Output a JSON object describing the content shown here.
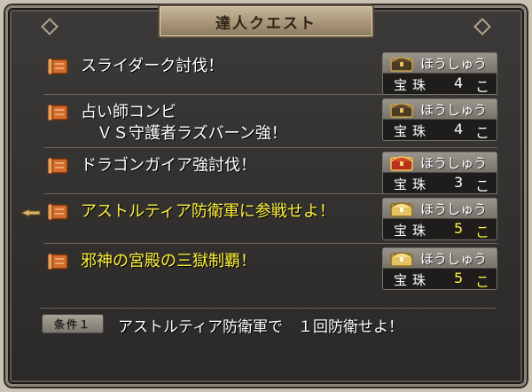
{
  "window": {
    "title": "達人クエスト"
  },
  "quests": [
    {
      "name": "スライダーク討伐！",
      "highlight": false,
      "reward_label": "ほうしゅう",
      "item": "宝珠",
      "count": "4",
      "unit": "こ",
      "chest": "dark-chest-icon"
    },
    {
      "name": "占い師コンビ\n　ＶＳ守護者ラズバーン強！",
      "highlight": false,
      "reward_label": "ほうしゅう",
      "item": "宝珠",
      "count": "4",
      "unit": "こ",
      "chest": "dark-chest-icon"
    },
    {
      "name": "ドラゴンガイア強討伐！",
      "highlight": false,
      "reward_label": "ほうしゅう",
      "item": "宝珠",
      "count": "3",
      "unit": "こ",
      "chest": "red-chest-icon"
    },
    {
      "name": "アストルティア防衛軍に参戦せよ！",
      "highlight": true,
      "reward_label": "ほうしゅう",
      "item": "宝珠",
      "count": "5",
      "unit": "こ",
      "chest": "gold-chest-icon"
    },
    {
      "name": "邪神の宮殿の三獄制覇！",
      "highlight": true,
      "reward_label": "ほうしゅう",
      "item": "宝珠",
      "count": "5",
      "unit": "こ",
      "chest": "gold-chest-icon"
    }
  ],
  "condition": {
    "badge": "条件１",
    "text": "アストルティア防衛軍で　１回防衛せよ！"
  },
  "colors": {
    "highlight": "#fff23c",
    "normal": "#ffffff",
    "frame": "#8c8478"
  }
}
